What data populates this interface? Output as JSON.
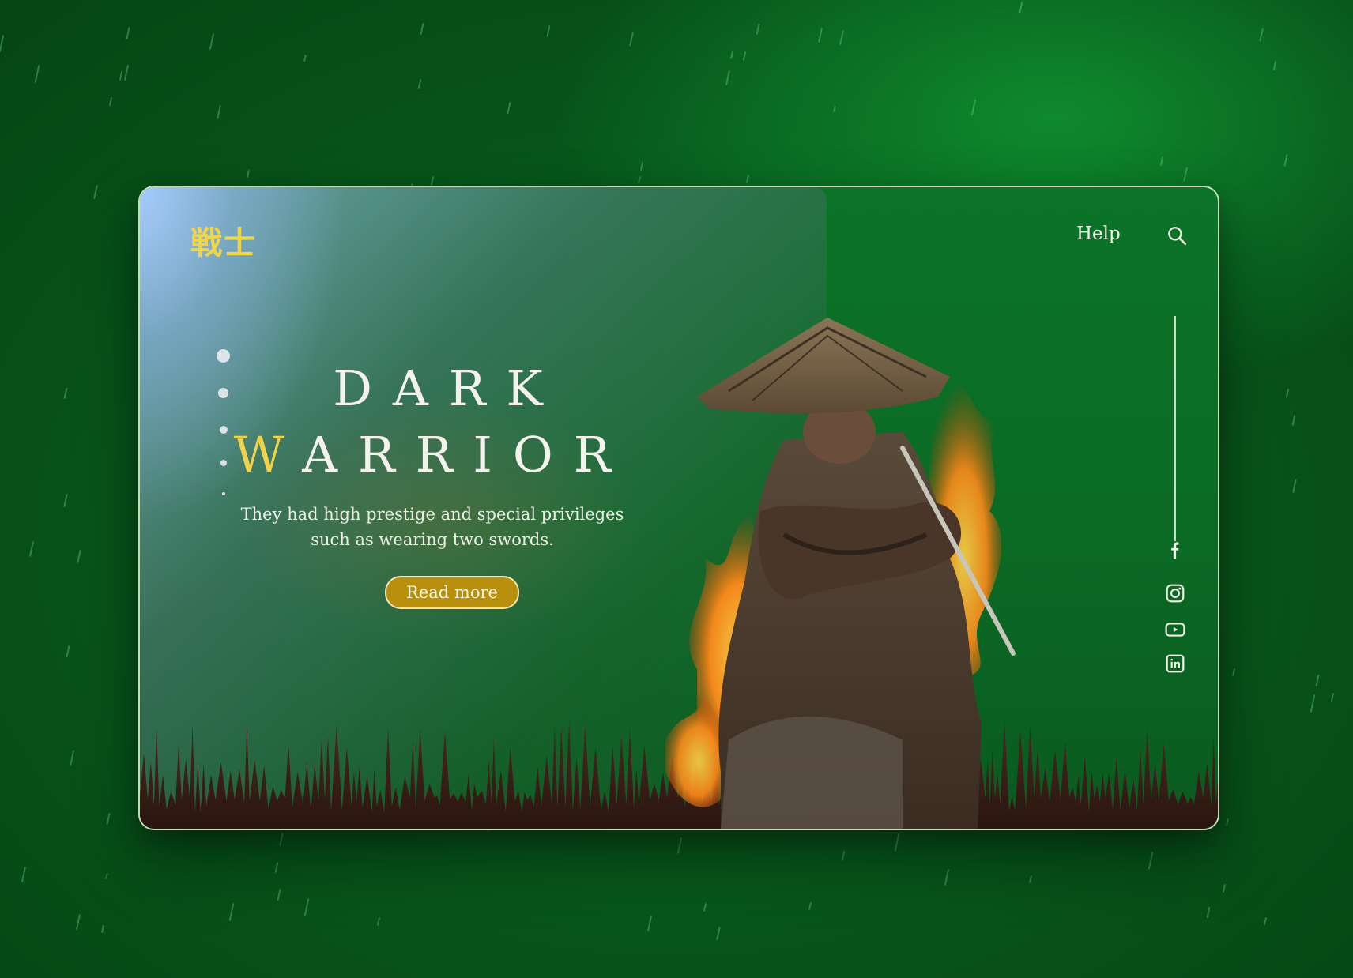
{
  "brand": {
    "logo_text": "戦士",
    "accent_color": "#f0d34b"
  },
  "nav": {
    "help_label": "Help",
    "search_icon": "search-icon"
  },
  "hero": {
    "title_line1": "DARK",
    "title_line2_accent": "W",
    "title_line2_rest": "ARRIOR",
    "subtitle": "They had high prestige and special privileges such as wearing two swords.",
    "cta_label": "Read more",
    "cta_color": "#b8900e"
  },
  "slider": {
    "dot_count": 5,
    "active_index": 0
  },
  "social": {
    "items": [
      "facebook-icon",
      "instagram-icon",
      "youtube-icon",
      "linkedin-icon"
    ]
  },
  "colors": {
    "background": "#0a6a22",
    "card_border": "#e6f0d2",
    "text": "#f4f2ec"
  }
}
